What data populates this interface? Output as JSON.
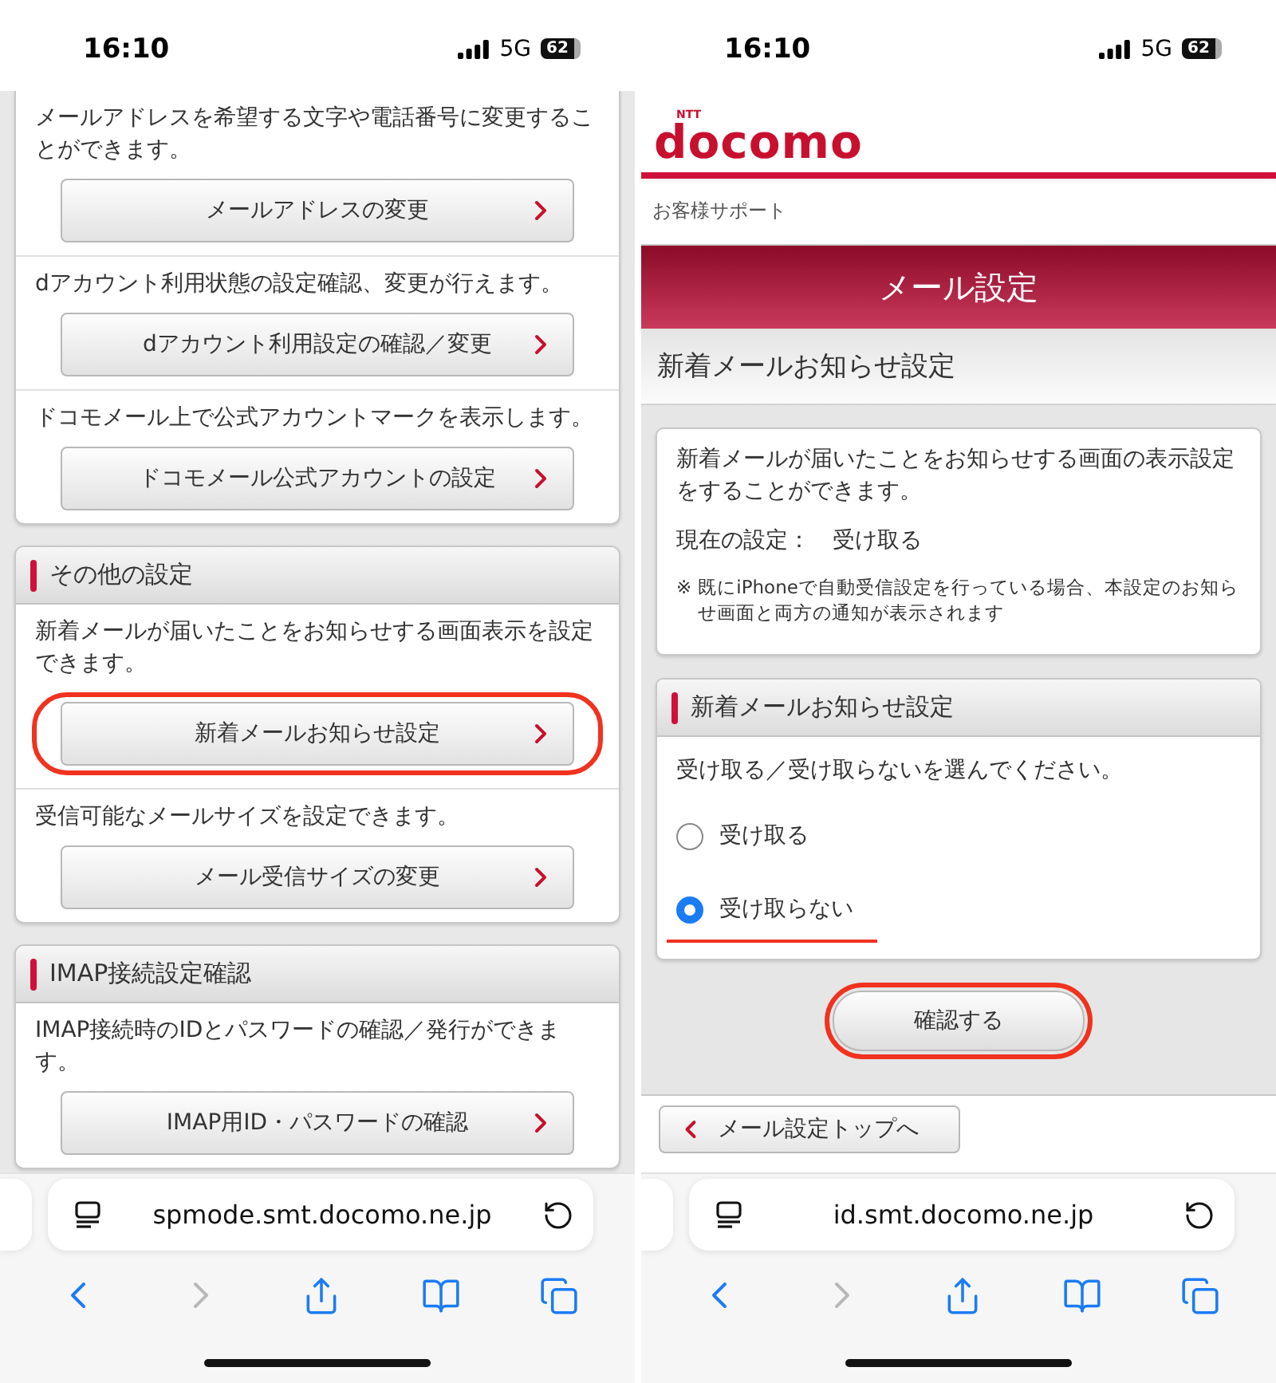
{
  "left_screen": {
    "status_bar": {
      "time": "16:10",
      "network": "5G",
      "battery": "62"
    },
    "cards": [
      {
        "sections": [
          {
            "description": "メールアドレスを希望する文字や電話番号に変更することができます。",
            "button": {
              "label": "メールアドレスの変更",
              "highlighted": false
            }
          },
          {
            "description": "dアカウント利用状態の設定確認、変更が行えます。",
            "button": {
              "label": "dアカウント利用設定の確認／変更",
              "highlighted": false
            }
          },
          {
            "description": "ドコモメール上で公式アカウントマークを表示します。",
            "button": {
              "label": "ドコモメール公式アカウントの設定",
              "highlighted": false
            }
          }
        ]
      },
      {
        "header": "その他の設定",
        "sections": [
          {
            "description": "新着メールが届いたことをお知らせする画面表示を設定できます。",
            "button": {
              "label": "新着メールお知らせ設定",
              "highlighted": true
            }
          },
          {
            "description": "受信可能なメールサイズを設定できます。",
            "button": {
              "label": "メール受信サイズの変更",
              "highlighted": false
            }
          }
        ]
      },
      {
        "header": "IMAP接続設定確認",
        "sections": [
          {
            "description": "IMAP接続時のIDとパスワードの確認／発行ができます。",
            "button": {
              "label": "IMAP用ID・パスワードの確認",
              "highlighted": false
            }
          }
        ]
      }
    ],
    "address_bar": {
      "url": "spmode.smt.docomo.ne.jp"
    },
    "toolbar": [
      {
        "kind": "back",
        "disabled": false
      },
      {
        "kind": "forward",
        "disabled": true
      },
      {
        "kind": "share",
        "disabled": false
      },
      {
        "kind": "bookmarks",
        "disabled": false
      },
      {
        "kind": "tabs",
        "disabled": false
      }
    ]
  },
  "right_screen": {
    "status_bar": {
      "time": "16:10",
      "network": "5G",
      "battery": "62"
    },
    "brand": {
      "small": "NTT",
      "name": "docomo"
    },
    "breadcrumb": "お客様サポート",
    "page_title": "メール設定",
    "section_title": "新着メールお知らせ設定",
    "info_card": {
      "description": "新着メールが届いたことをお知らせする画面の表示設定をすることができます。",
      "current_setting": "現在の設定：　受け取る",
      "note_mark": "※",
      "note": "既にiPhoneで自動受信設定を行っている場合、本設定のお知らせ画面と両方の通知が表示されます"
    },
    "option_card": {
      "header": "新着メールお知らせ設定",
      "prompt": "受け取る／受け取らないを選んでください。",
      "options": [
        {
          "label": "受け取る",
          "selected": false,
          "underlined": false
        },
        {
          "label": "受け取らない",
          "selected": true,
          "underlined": true
        }
      ]
    },
    "confirm_button": {
      "label": "確認する",
      "highlighted": true
    },
    "back_link": {
      "label": "メール設定トップへ"
    },
    "address_bar": {
      "url": "id.smt.docomo.ne.jp"
    },
    "toolbar": [
      {
        "kind": "back",
        "disabled": false
      },
      {
        "kind": "forward",
        "disabled": true
      },
      {
        "kind": "share",
        "disabled": false
      },
      {
        "kind": "bookmarks",
        "disabled": false
      },
      {
        "kind": "tabs",
        "disabled": false
      }
    ]
  }
}
